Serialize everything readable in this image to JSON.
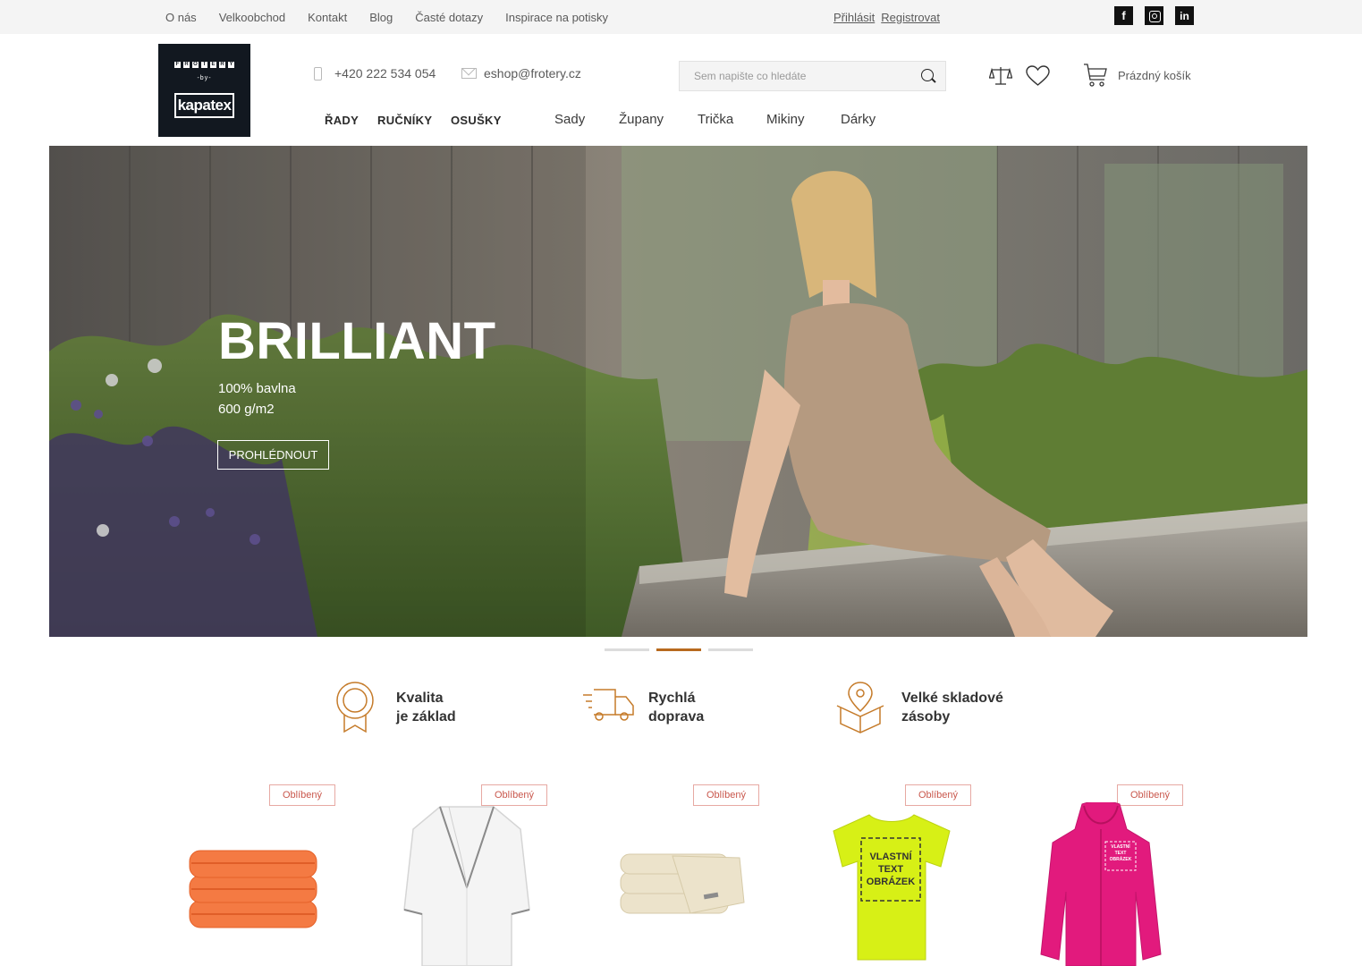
{
  "topbar": {
    "links": [
      "O nás",
      "Velkoobchod",
      "Kontakt",
      "Blog",
      "Časté dotazy",
      "Inspirace na potisky"
    ],
    "login": "Přihlásit",
    "register": "Registrovat",
    "social": [
      {
        "icon": "facebook-icon",
        "glyph": "f"
      },
      {
        "icon": "instagram-icon",
        "glyph": ""
      },
      {
        "icon": "linkedin-icon",
        "glyph": "in"
      }
    ]
  },
  "header": {
    "logo": {
      "line1": "FROTERY",
      "line2": "-by-",
      "line3": "kapatex"
    },
    "phone": "+420 222 534 054",
    "email": "eshop@frotery.cz",
    "search_placeholder": "Sem napište co hledáte",
    "cart_label": "Prázdný košík"
  },
  "nav": {
    "primary": [
      "ŘADY",
      "RUČNÍKY",
      "OSUŠKY"
    ],
    "secondary": [
      "Sady",
      "Župany",
      "Trička",
      "Mikiny",
      "Dárky"
    ]
  },
  "hero": {
    "title": "BRILLIANT",
    "line1": "100% bavlna",
    "line2": "600 g/m2",
    "button": "PROHLÉDNOUT",
    "slides": 3,
    "active_slide": 2
  },
  "features": [
    {
      "icon": "quality-medal-icon",
      "line1": "Kvalita",
      "line2": "je základ"
    },
    {
      "icon": "fast-delivery-truck-icon",
      "line1": "Rychlá",
      "line2": "doprava"
    },
    {
      "icon": "stock-box-icon",
      "line1": "Velké skladové",
      "line2": "zásoby"
    }
  ],
  "products": [
    {
      "badge": "Oblíbený",
      "image": "orange-towels-image"
    },
    {
      "badge": "Oblíbený",
      "image": "white-bathrobe-image"
    },
    {
      "badge": "Oblíbený",
      "image": "beige-towels-image"
    },
    {
      "badge": "Oblíbený",
      "image": "yellow-tshirt-image",
      "print_text": [
        "VLASTNÍ",
        "TEXT",
        "OBRÁZEK"
      ]
    },
    {
      "badge": "Oblíbený",
      "image": "pink-hoodie-image",
      "print_text": [
        "VLASTNÍ",
        "TEXT",
        "OBRÁZEK"
      ]
    }
  ],
  "colors": {
    "accent": "#b86a1e",
    "badge": "#c9574c",
    "topbar_bg": "#f4f4f4",
    "logo_bg": "#121820"
  }
}
